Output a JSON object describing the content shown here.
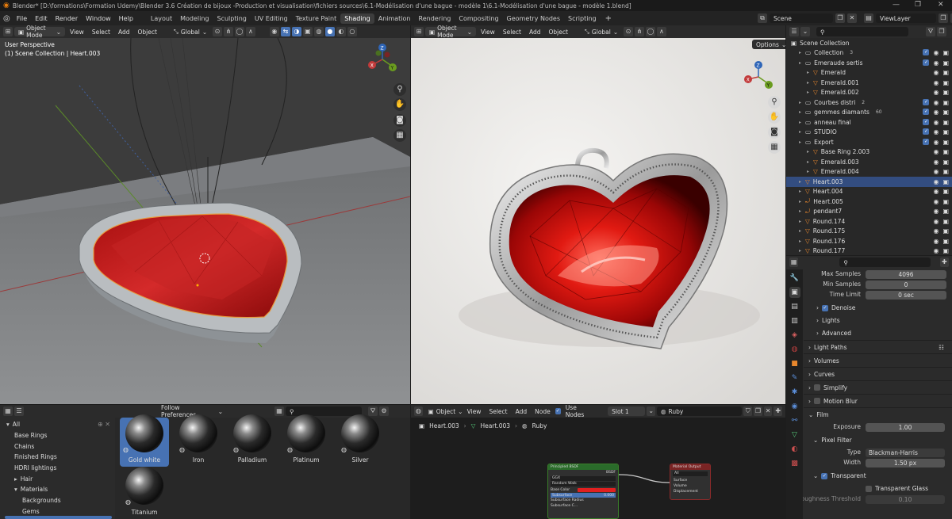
{
  "window": {
    "title": "Blender* [D:\\formations\\Formation Udemy\\Blender 3.6 Création de bijoux -Production et visualisation\\fichiers sources\\6.1-Modélisation d'une bague - modèle 1\\6.1-Modélisation d'une bague - modèle 1.blend]"
  },
  "menu": [
    "File",
    "Edit",
    "Render",
    "Window",
    "Help"
  ],
  "workspaces": [
    {
      "label": "Layout",
      "active": false
    },
    {
      "label": "Modeling",
      "active": false
    },
    {
      "label": "Sculpting",
      "active": false
    },
    {
      "label": "UV Editing",
      "active": false
    },
    {
      "label": "Texture Paint",
      "active": false
    },
    {
      "label": "Shading",
      "active": true
    },
    {
      "label": "Animation",
      "active": false
    },
    {
      "label": "Rendering",
      "active": false
    },
    {
      "label": "Compositing",
      "active": false
    },
    {
      "label": "Geometry Nodes",
      "active": false
    },
    {
      "label": "Scripting",
      "active": false
    }
  ],
  "workspace_add": "+",
  "scene": {
    "name": "Scene",
    "view_layer": "ViewLayer"
  },
  "viewport_left": {
    "mode": "Object Mode",
    "menus": [
      "View",
      "Select",
      "Add",
      "Object"
    ],
    "orientation": "Global",
    "overlay_title": "User Perspective",
    "overlay_subtitle": "(1) Scene Collection | Heart.003"
  },
  "viewport_right": {
    "mode": "Object Mode",
    "menus": [
      "View",
      "Select",
      "Add",
      "Object"
    ],
    "orientation": "Global",
    "options_label": "Options"
  },
  "gizmo_axes": {
    "x": "X",
    "y": "Y",
    "z": "Z"
  },
  "outliner": {
    "root": "Scene Collection",
    "rows": [
      {
        "label": "Collection",
        "indent": 1,
        "icon": "collection-icon",
        "extra": "3",
        "checked": true,
        "selected": false
      },
      {
        "label": "Emeraude sertis",
        "indent": 1,
        "icon": "collection-icon",
        "extra": "",
        "checked": true,
        "selected": false
      },
      {
        "label": "Emerald",
        "indent": 2,
        "icon": "mesh-icon",
        "extra": "",
        "checked": false,
        "selected": false
      },
      {
        "label": "Emerald.001",
        "indent": 2,
        "icon": "mesh-icon",
        "extra": "",
        "checked": false,
        "selected": false
      },
      {
        "label": "Emerald.002",
        "indent": 2,
        "icon": "mesh-icon",
        "extra": "",
        "checked": false,
        "selected": false
      },
      {
        "label": "Courbes distri",
        "indent": 1,
        "icon": "collection-icon",
        "extra": "2",
        "checked": true,
        "selected": false
      },
      {
        "label": "gemmes diamants",
        "indent": 1,
        "icon": "collection-icon",
        "extra": "60",
        "checked": true,
        "selected": false
      },
      {
        "label": "anneau final",
        "indent": 1,
        "icon": "collection-icon",
        "extra": "",
        "checked": true,
        "selected": false
      },
      {
        "label": "STUDIO",
        "indent": 1,
        "icon": "collection-icon",
        "extra": "",
        "checked": true,
        "selected": false
      },
      {
        "label": "Export",
        "indent": 1,
        "icon": "collection-icon",
        "extra": "",
        "checked": true,
        "selected": false
      },
      {
        "label": "Base Ring 2.003",
        "indent": 2,
        "icon": "mesh-icon",
        "extra": "",
        "checked": false,
        "selected": false
      },
      {
        "label": "Emerald.003",
        "indent": 2,
        "icon": "mesh-icon",
        "extra": "",
        "checked": false,
        "selected": false
      },
      {
        "label": "Emerald.004",
        "indent": 2,
        "icon": "mesh-icon",
        "extra": "",
        "checked": false,
        "selected": false
      },
      {
        "label": "Heart.003",
        "indent": 1,
        "icon": "mesh-icon",
        "extra": "",
        "checked": false,
        "selected": true
      },
      {
        "label": "Heart.004",
        "indent": 1,
        "icon": "mesh-icon",
        "extra": "",
        "checked": false,
        "selected": false
      },
      {
        "label": "Heart.005",
        "indent": 1,
        "icon": "curve-icon",
        "extra": "",
        "checked": false,
        "selected": false
      },
      {
        "label": "pendant7",
        "indent": 1,
        "icon": "curve-icon",
        "extra": "",
        "checked": false,
        "selected": false
      },
      {
        "label": "Round.174",
        "indent": 1,
        "icon": "mesh-icon",
        "extra": "",
        "checked": false,
        "selected": false
      },
      {
        "label": "Round.175",
        "indent": 1,
        "icon": "mesh-icon",
        "extra": "",
        "checked": false,
        "selected": false
      },
      {
        "label": "Round.176",
        "indent": 1,
        "icon": "mesh-icon",
        "extra": "",
        "checked": false,
        "selected": false
      },
      {
        "label": "Round.177",
        "indent": 1,
        "icon": "mesh-icon",
        "extra": "",
        "checked": false,
        "selected": false
      }
    ]
  },
  "properties": {
    "fields": [
      {
        "label": "Max Samples",
        "value": "4096"
      },
      {
        "label": "Min Samples",
        "value": "0"
      },
      {
        "label": "Time Limit",
        "value": "0 sec"
      }
    ],
    "sub_sections": [
      {
        "label": "Denoise",
        "checkbox": true
      },
      {
        "label": "Lights",
        "checkbox": null
      },
      {
        "label": "Advanced",
        "checkbox": null
      }
    ],
    "sections": [
      {
        "label": "Light Paths",
        "checkbox": null
      },
      {
        "label": "Volumes",
        "checkbox": null
      },
      {
        "label": "Curves",
        "checkbox": null
      },
      {
        "label": "Simplify",
        "checkbox": false
      },
      {
        "label": "Motion Blur",
        "checkbox": false
      }
    ],
    "film": {
      "label": "Film",
      "exposure_label": "Exposure",
      "exposure": "1.00",
      "pixel_filter_label": "Pixel Filter",
      "type_label": "Type",
      "type": "Blackman-Harris",
      "width_label": "Width",
      "width": "1.50 px",
      "transparent_label": "Transparent",
      "transparent_glass_label": "Transparent Glass",
      "roughness_label": "Roughness Threshold",
      "roughness": "0.10"
    }
  },
  "asset_browser": {
    "import_mode": "Follow Preferences",
    "categories": [
      {
        "label": "All",
        "indent": 0,
        "arrow": "▾"
      },
      {
        "label": "Base Rings",
        "indent": 1,
        "arrow": ""
      },
      {
        "label": "Chains",
        "indent": 1,
        "arrow": ""
      },
      {
        "label": "Finished Rings",
        "indent": 1,
        "arrow": ""
      },
      {
        "label": "HDRI lightings",
        "indent": 1,
        "arrow": ""
      },
      {
        "label": "Hair",
        "indent": 1,
        "arrow": "▸"
      },
      {
        "label": "Materials",
        "indent": 1,
        "arrow": "▾"
      },
      {
        "label": "Backgrounds",
        "indent": 2,
        "arrow": ""
      },
      {
        "label": "Gems",
        "indent": 2,
        "arrow": ""
      }
    ],
    "items": [
      {
        "label": "Gold white",
        "selected": true
      },
      {
        "label": "Iron",
        "selected": false
      },
      {
        "label": "Palladium",
        "selected": false
      },
      {
        "label": "Platinum",
        "selected": false
      },
      {
        "label": "Silver",
        "selected": false
      },
      {
        "label": "Titanium",
        "selected": false
      }
    ]
  },
  "node_editor": {
    "mode": "Object",
    "menus": [
      "View",
      "Select",
      "Add",
      "Node"
    ],
    "use_nodes_label": "Use Nodes",
    "slot": "Slot 1",
    "material": "Ruby",
    "breadcrumb": [
      "Heart.003",
      "Heart.003",
      "Ruby"
    ],
    "bsdf_node": {
      "title": "Principled BSDF",
      "output": "BSDF",
      "rows": [
        "GGX",
        "Random Walk",
        "Base Color",
        "Subsurface",
        "Subsurface Radius",
        "Subsurface C..."
      ],
      "subsurface_value": "0.000"
    },
    "output_node": {
      "title": "Material Output",
      "target": "All",
      "sockets": [
        "Surface",
        "Volume",
        "Displacement"
      ]
    }
  },
  "colors": {
    "accent": "#4772b3",
    "selection": "#334d80",
    "ruby": "#c81a1a",
    "shader_header": "#2a6b2a",
    "output_header": "#7a2424"
  }
}
